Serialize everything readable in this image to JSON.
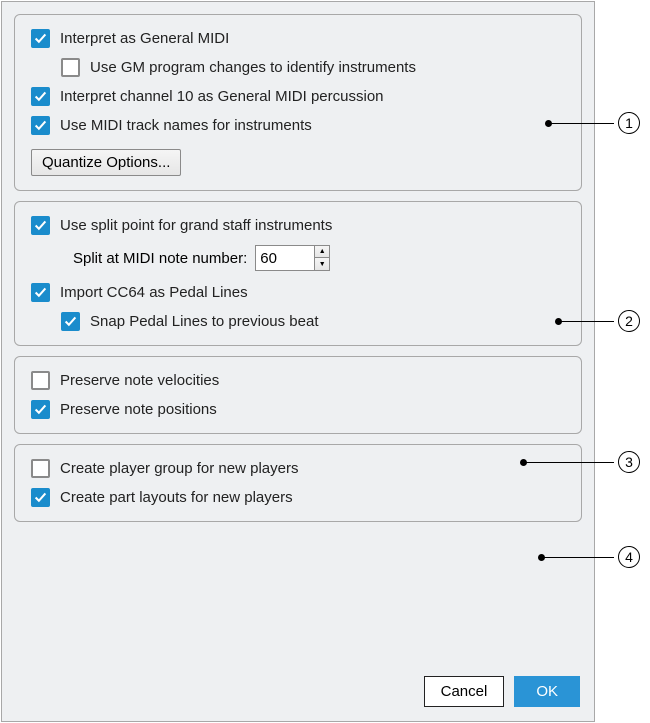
{
  "section1": {
    "interpret_gm": "Interpret as General MIDI",
    "use_gm_program": "Use GM program changes to identify instruments",
    "channel10": "Interpret channel 10 as General MIDI percussion",
    "midi_track_names": "Use MIDI track names for instruments",
    "quantize_btn": "Quantize Options..."
  },
  "section2": {
    "use_split": "Use split point for grand staff instruments",
    "split_label": "Split at MIDI note number:",
    "split_value": "60",
    "import_cc64": "Import CC64 as Pedal Lines",
    "snap_pedal": "Snap Pedal Lines to previous beat"
  },
  "section3": {
    "preserve_vel": "Preserve note velocities",
    "preserve_pos": "Preserve note positions"
  },
  "section4": {
    "create_group": "Create player group for new players",
    "create_parts": "Create part layouts for new players"
  },
  "footer": {
    "cancel": "Cancel",
    "ok": "OK"
  },
  "callouts": [
    "1",
    "2",
    "3",
    "4"
  ]
}
